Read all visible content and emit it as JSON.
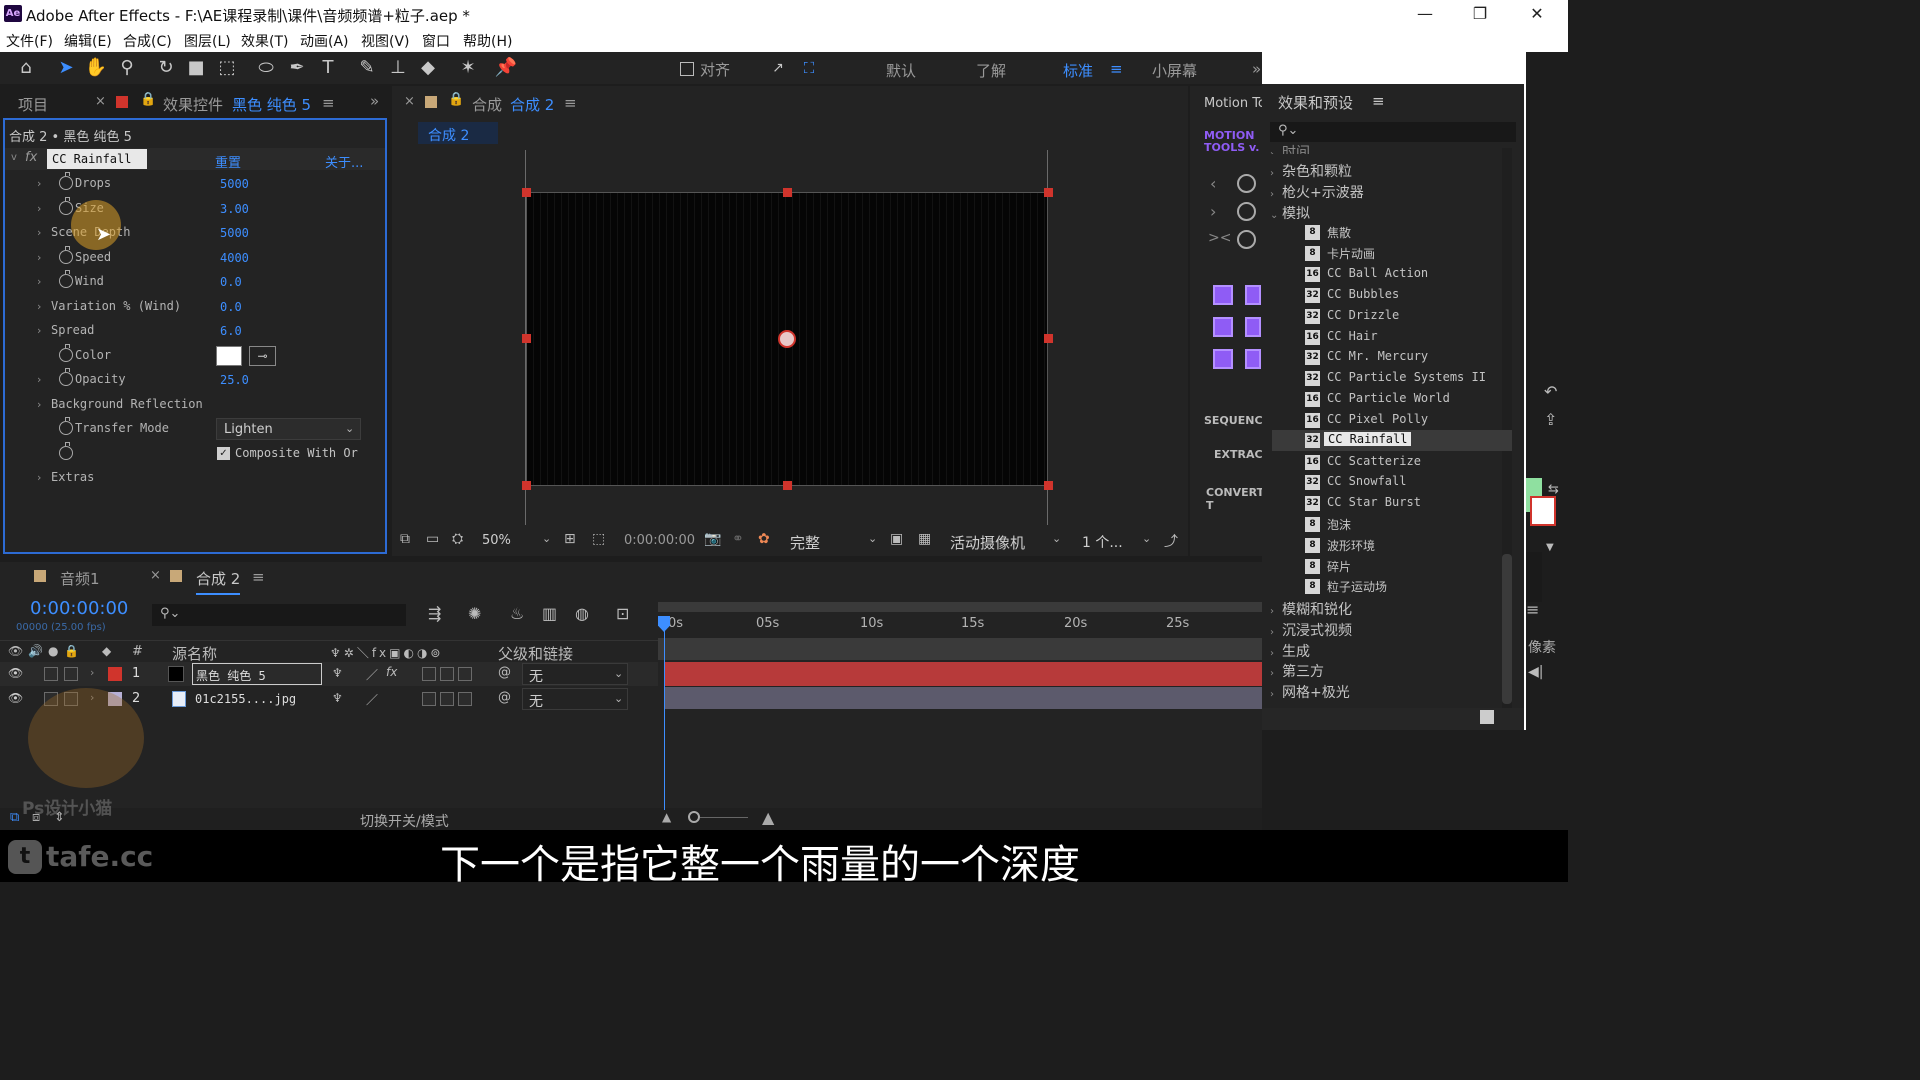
{
  "app": {
    "logo": "Ae",
    "title": "Adobe After Effects - F:\\AE课程录制\\课件\\音频频谱+粒子.aep *"
  },
  "menu": [
    "文件(F)",
    "编辑(E)",
    "合成(C)",
    "图层(L)",
    "效果(T)",
    "动画(A)",
    "视图(V)",
    "窗口",
    "帮助(H)"
  ],
  "toolbar": {
    "align_label": "对齐",
    "workspaces": [
      "默认",
      "了解",
      "标准",
      "小屏幕"
    ],
    "active_workspace": "标准"
  },
  "effect_controls": {
    "tab_project": "项目",
    "tab_label": "效果控件",
    "tab_layer": "黑色 纯色 5",
    "breadcrumb": "合成 2 • 黑色 纯色 5",
    "effect_name": "CC Rainfall",
    "reset_label": "重置",
    "about_label": "关于...",
    "params": [
      {
        "name": "Drops",
        "value": "5000"
      },
      {
        "name": "Size",
        "value": "3.00"
      },
      {
        "name": "Scene Depth",
        "value": "5000"
      },
      {
        "name": "Speed",
        "value": "4000"
      },
      {
        "name": "Wind",
        "value": "0.0"
      },
      {
        "name": "Variation % (Wind)",
        "value": "0.0"
      },
      {
        "name": "Spread",
        "value": "6.0"
      },
      {
        "name": "Color",
        "value": ""
      },
      {
        "name": "Opacity",
        "value": "25.0"
      },
      {
        "name": "Background Reflection",
        "value": ""
      },
      {
        "name": "Transfer Mode",
        "value": "Lighten"
      },
      {
        "name": "",
        "value": "Composite With Or"
      },
      {
        "name": "Extras",
        "value": ""
      }
    ],
    "color_swatch": "#ffffff"
  },
  "composition": {
    "tab_prefix": "合成",
    "tab_name": "合成 2",
    "subtab": "合成 2",
    "zoom": "50%",
    "timecode": "0:00:00:00",
    "quality": "完整",
    "camera": "活动摄像机",
    "views": "1 个..."
  },
  "motion_tools": {
    "tab": "Motion Tc",
    "logo": "MOTION TOOLS v.",
    "sections": [
      "SEQUENCI",
      "EXTRACT",
      "CONVERT T"
    ]
  },
  "effects_presets": {
    "title": "效果和预设",
    "categories_top": [
      "时间",
      "杂色和颗粒",
      "枪火+示波器",
      "模拟"
    ],
    "items": [
      {
        "bits": "8",
        "name": "焦散"
      },
      {
        "bits": "8",
        "name": "卡片动画"
      },
      {
        "bits": "16",
        "name": "CC Ball Action"
      },
      {
        "bits": "32",
        "name": "CC Bubbles"
      },
      {
        "bits": "32",
        "name": "CC Drizzle"
      },
      {
        "bits": "16",
        "name": "CC Hair"
      },
      {
        "bits": "32",
        "name": "CC Mr. Mercury"
      },
      {
        "bits": "32",
        "name": "CC Particle Systems II"
      },
      {
        "bits": "16",
        "name": "CC Particle World"
      },
      {
        "bits": "16",
        "name": "CC Pixel Polly"
      },
      {
        "bits": "32",
        "name": "CC Rainfall"
      },
      {
        "bits": "16",
        "name": "CC Scatterize"
      },
      {
        "bits": "32",
        "name": "CC Snowfall"
      },
      {
        "bits": "32",
        "name": "CC Star Burst"
      },
      {
        "bits": "8",
        "name": "泡沫"
      },
      {
        "bits": "8",
        "name": "波形环境"
      },
      {
        "bits": "8",
        "name": "碎片"
      },
      {
        "bits": "8",
        "name": "粒子运动场"
      }
    ],
    "selected": "CC Rainfall",
    "categories_bottom": [
      "模糊和锐化",
      "沉浸式视频",
      "生成",
      "第三方",
      "网格+极光"
    ]
  },
  "timeline": {
    "tab_audio": "音频1",
    "tab_comp": "合成 2",
    "timecode": "0:00:00:00",
    "frames": "00000 (25.00 fps)",
    "col_num": "#",
    "col_source": "源名称",
    "col_parent": "父级和链接",
    "layers": [
      {
        "num": "1",
        "name": "黑色 纯色 5",
        "parent": "无",
        "color": "#d0342c"
      },
      {
        "num": "2",
        "name": "01c2155....jpg",
        "parent": "无",
        "color": "#b6b0d6"
      }
    ],
    "ruler": [
      "0s",
      "05s",
      "10s",
      "15s",
      "20s",
      "25s"
    ],
    "switch_mode": "切换开关/模式"
  },
  "right_strip": {
    "label": "像素"
  },
  "watermark": {
    "text": "Ps设计小猫",
    "site": "tafe.cc"
  },
  "subtitle": "下一个是指它整一个雨量的一个深度"
}
